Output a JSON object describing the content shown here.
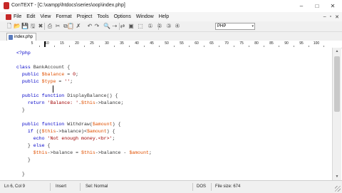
{
  "window": {
    "title": "ConTEXT - [C:\\xampp\\htdocs\\series\\oop\\index.php]",
    "controls": {
      "minimize": "–",
      "maximize": "□",
      "close": "✕"
    }
  },
  "menu": {
    "items": [
      "File",
      "Edit",
      "View",
      "Format",
      "Project",
      "Tools",
      "Options",
      "Window",
      "Help"
    ],
    "mdi_controls": {
      "minimize": "–",
      "restore": "▫",
      "close": "✕"
    }
  },
  "toolbar": {
    "buttons": [
      {
        "name": "new-file-icon",
        "glyph": "🗋"
      },
      {
        "name": "open-file-icon",
        "glyph": "📂"
      },
      {
        "name": "save-icon",
        "glyph": "💾"
      },
      {
        "name": "save-all-icon",
        "glyph": "🖫"
      },
      {
        "name": "close-file-icon",
        "glyph": "✖"
      },
      {
        "name": "print-icon",
        "glyph": "⎙"
      },
      {
        "name": "cut-icon",
        "glyph": "✂"
      },
      {
        "name": "copy-icon",
        "glyph": "⧉"
      },
      {
        "name": "paste-icon",
        "glyph": "📋"
      },
      {
        "name": "delete-icon",
        "glyph": "✗"
      },
      {
        "name": "undo-icon",
        "glyph": "↶"
      },
      {
        "name": "redo-icon",
        "glyph": "↷"
      },
      {
        "name": "find-icon",
        "glyph": "🔍"
      },
      {
        "name": "find-next-icon",
        "glyph": "⇢"
      },
      {
        "name": "replace-icon",
        "glyph": "⇄"
      },
      {
        "name": "bookmark-icon",
        "glyph": "▣"
      },
      {
        "name": "goto-icon",
        "glyph": "⬚"
      },
      {
        "name": "user-command-1-icon",
        "glyph": "①"
      },
      {
        "name": "user-command-2-icon",
        "glyph": "②"
      },
      {
        "name": "user-command-3-icon",
        "glyph": "③"
      },
      {
        "name": "user-command-4-icon",
        "glyph": "④"
      }
    ],
    "highlighter": {
      "value": "PHP",
      "arrow": "▾"
    }
  },
  "tabs": [
    {
      "label": "index.php"
    }
  ],
  "ruler": {
    "numbers": [
      "5",
      "10",
      "15",
      "20",
      "25",
      "30",
      "35",
      "40",
      "45",
      "50",
      "55",
      "60",
      "65",
      "70",
      "75",
      "80",
      "85",
      "90",
      "95",
      "100"
    ]
  },
  "code": {
    "lines": [
      [
        {
          "t": "<?php",
          "c": "kw"
        }
      ],
      [],
      [
        {
          "t": "class ",
          "c": "kw"
        },
        {
          "t": "BankAccount {",
          "c": "op"
        }
      ],
      [
        {
          "t": "  public ",
          "c": "kw"
        },
        {
          "t": "$balance",
          "c": "vr"
        },
        {
          "t": " = ",
          "c": "op"
        },
        {
          "t": "0",
          "c": "st"
        },
        {
          "t": ";",
          "c": "op"
        }
      ],
      [
        {
          "t": "  public ",
          "c": "kw"
        },
        {
          "t": "$type",
          "c": "vr"
        },
        {
          "t": " = ",
          "c": "op"
        },
        {
          "t": "''",
          "c": "st"
        },
        {
          "t": ";",
          "c": "op"
        }
      ],
      [],
      [
        {
          "t": "  public function ",
          "c": "kw"
        },
        {
          "t": "DisplayBalance() {",
          "c": "op"
        }
      ],
      [
        {
          "t": "    return ",
          "c": "kw"
        },
        {
          "t": "'Balance: '",
          "c": "st"
        },
        {
          "t": ".",
          "c": "op"
        },
        {
          "t": "$this",
          "c": "vr"
        },
        {
          "t": "->balance;",
          "c": "op"
        }
      ],
      [
        {
          "t": "  }",
          "c": "op"
        }
      ],
      [],
      [
        {
          "t": "  public function ",
          "c": "kw"
        },
        {
          "t": "Withdraw(",
          "c": "op"
        },
        {
          "t": "$amount",
          "c": "vr"
        },
        {
          "t": ") {",
          "c": "op"
        }
      ],
      [
        {
          "t": "    if ",
          "c": "kw"
        },
        {
          "t": "((",
          "c": "op"
        },
        {
          "t": "$this",
          "c": "vr"
        },
        {
          "t": "->balance)<",
          "c": "op"
        },
        {
          "t": "$amount",
          "c": "vr"
        },
        {
          "t": ") {",
          "c": "op"
        }
      ],
      [
        {
          "t": "      echo ",
          "c": "kw"
        },
        {
          "t": "'Not enough money.<br>'",
          "c": "st"
        },
        {
          "t": ";",
          "c": "op"
        }
      ],
      [
        {
          "t": "    } ",
          "c": "op"
        },
        {
          "t": "else ",
          "c": "kw"
        },
        {
          "t": "{",
          "c": "op"
        }
      ],
      [
        {
          "t": "      ",
          "c": "op"
        },
        {
          "t": "$this",
          "c": "vr"
        },
        {
          "t": "->balance = ",
          "c": "op"
        },
        {
          "t": "$this",
          "c": "vr"
        },
        {
          "t": "->balance - ",
          "c": "op"
        },
        {
          "t": "$amount",
          "c": "vr"
        },
        {
          "t": ";",
          "c": "op"
        }
      ],
      [
        {
          "t": "    }",
          "c": "op"
        }
      ],
      [],
      [
        {
          "t": "  }",
          "c": "op"
        }
      ]
    ]
  },
  "scrollbar": {
    "up": "▲",
    "down": "▼"
  },
  "status": {
    "position": "Ln 6, Col 9",
    "mode": "Insert",
    "selection": "Sel: Normal",
    "line_ending": "DOS",
    "file_size": "File size: 674"
  },
  "colors": {
    "keyword": "#0000c8",
    "variable": "#e05000",
    "string": "#a00000"
  }
}
